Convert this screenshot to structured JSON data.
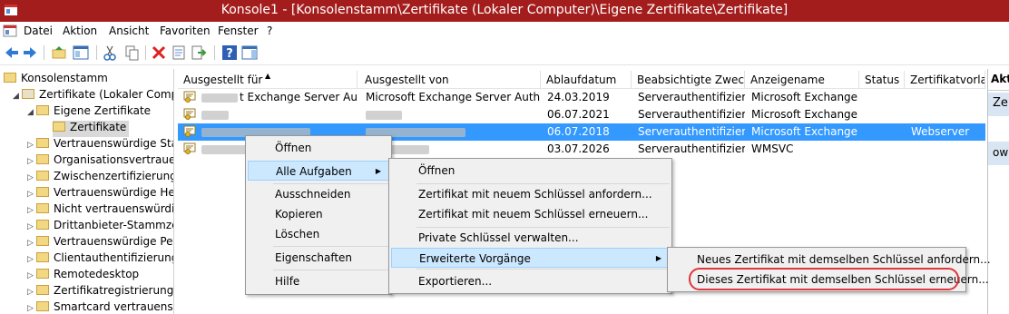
{
  "window": {
    "title": "Konsole1 - [Konsolenstamm\\Zertifikate (Lokaler Computer)\\Eigene Zertifikate\\Zertifikate]"
  },
  "menubar": [
    "Datei",
    "Aktion",
    "Ansicht",
    "Favoriten",
    "Fenster",
    "?"
  ],
  "tree": {
    "root": "Konsolenstamm",
    "store": "Zertifikate (Lokaler Comput",
    "personal": "Eigene Zertifikate",
    "certs": "Zertifikate",
    "others": [
      "Vertrauenswürdige Stam",
      "Organisationsvertrauen",
      "Zwischenzertifizierungss",
      "Vertrauenswürdige Hera",
      "Nicht vertrauenswürdige",
      "Drittanbieter-Stammzert",
      "Vertrauenswürdige Perso",
      "Clientauthentifizierungs",
      "Remotedesktop",
      "Zertifikatregistrierungsa",
      "Smartcard vertrauenswü"
    ]
  },
  "list": {
    "headers": [
      "Ausgestellt für",
      "Ausgestellt von",
      "Ablaufdatum",
      "Beabsichtigte Zwec...",
      "Anzeigename",
      "Status",
      "Zertifikatvorlag"
    ],
    "rows": [
      {
        "for": "t Exchange Server Aut...",
        "by": "Microsoft Exchange Server Auth C...",
        "exp": "24.03.2019",
        "purpose": "Serverauthentifizier...",
        "name": "Microsoft Exchange...",
        "status": "",
        "tpl": ""
      },
      {
        "for": "",
        "by": "",
        "exp": "06.07.2021",
        "purpose": "Serverauthentifizier...",
        "name": "Microsoft Exchange",
        "status": "",
        "tpl": ""
      },
      {
        "for": "",
        "by": "",
        "exp": "06.07.2018",
        "purpose": "Serverauthentifizier...",
        "name": "Microsoft Exchange",
        "status": "",
        "tpl": "Webserver"
      },
      {
        "for": "",
        "by": "",
        "exp": "03.07.2026",
        "purpose": "Serverauthentifizier...",
        "name": "WMSVC",
        "status": "",
        "tpl": ""
      }
    ]
  },
  "actions": {
    "header": "Akt",
    "item1": "Ze",
    "item2": "ow"
  },
  "context_menu": [
    "Öffnen",
    "Alle Aufgaben",
    "Ausschneiden",
    "Kopieren",
    "Löschen",
    "Eigenschaften",
    "Hilfe"
  ],
  "submenu1": [
    "Öffnen",
    "Zertifikat mit neuem Schlüssel anfordern...",
    "Zertifikat mit neuem Schlüssel erneuern...",
    "Private Schlüssel verwalten...",
    "Erweiterte Vorgänge",
    "Exportieren..."
  ],
  "submenu2": [
    "Neues Zertifikat mit demselben Schlüssel anfordern...",
    "Dieses Zertifikat mit demselben Schlüssel erneuern..."
  ],
  "colors": {
    "titlebar": "#a41d1d",
    "selection": "#3399ff",
    "highlight": "#cce8ff",
    "circle": "#e0353a"
  }
}
